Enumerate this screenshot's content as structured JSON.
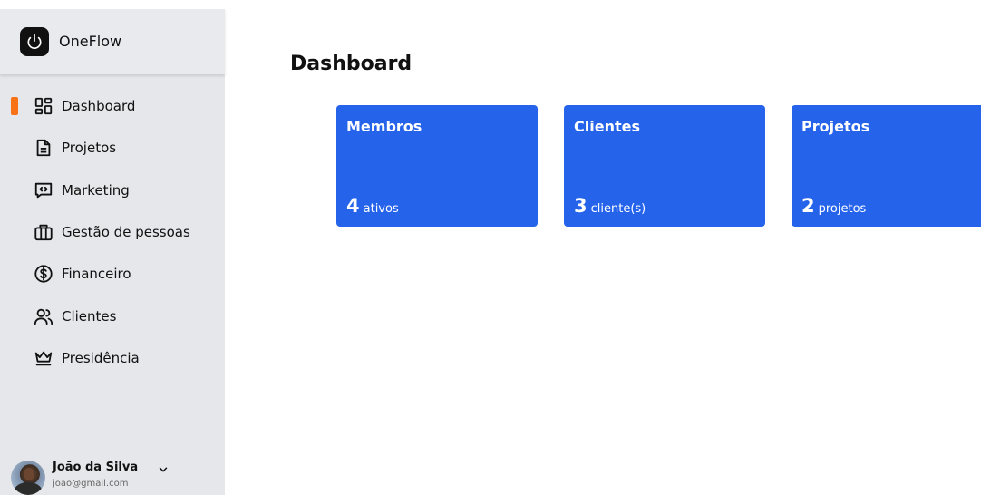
{
  "brand": {
    "name": "OneFlow",
    "logo_icon": "power-icon"
  },
  "nav": {
    "active_index": 0,
    "accent_color": "#f97316",
    "items": [
      {
        "label": "Dashboard",
        "icon": "dashboard-icon"
      },
      {
        "label": "Projetos",
        "icon": "document-icon"
      },
      {
        "label": "Marketing",
        "icon": "chat-code-icon"
      },
      {
        "label": "Gestão de pessoas",
        "icon": "briefcase-icon"
      },
      {
        "label": "Financeiro",
        "icon": "dollar-circle-icon"
      },
      {
        "label": "Clientes",
        "icon": "users-icon"
      },
      {
        "label": "Presidência",
        "icon": "crown-icon"
      }
    ]
  },
  "user": {
    "name": "João da Silva",
    "email": "joao@gmail.com"
  },
  "main": {
    "title": "Dashboard",
    "card_color": "#2563eb",
    "cards": [
      {
        "title": "Membros",
        "value": "4",
        "unit": "ativos"
      },
      {
        "title": "Clientes",
        "value": "3",
        "unit": "cliente(s)"
      },
      {
        "title": "Projetos",
        "value": "2",
        "unit": "projetos"
      }
    ]
  }
}
